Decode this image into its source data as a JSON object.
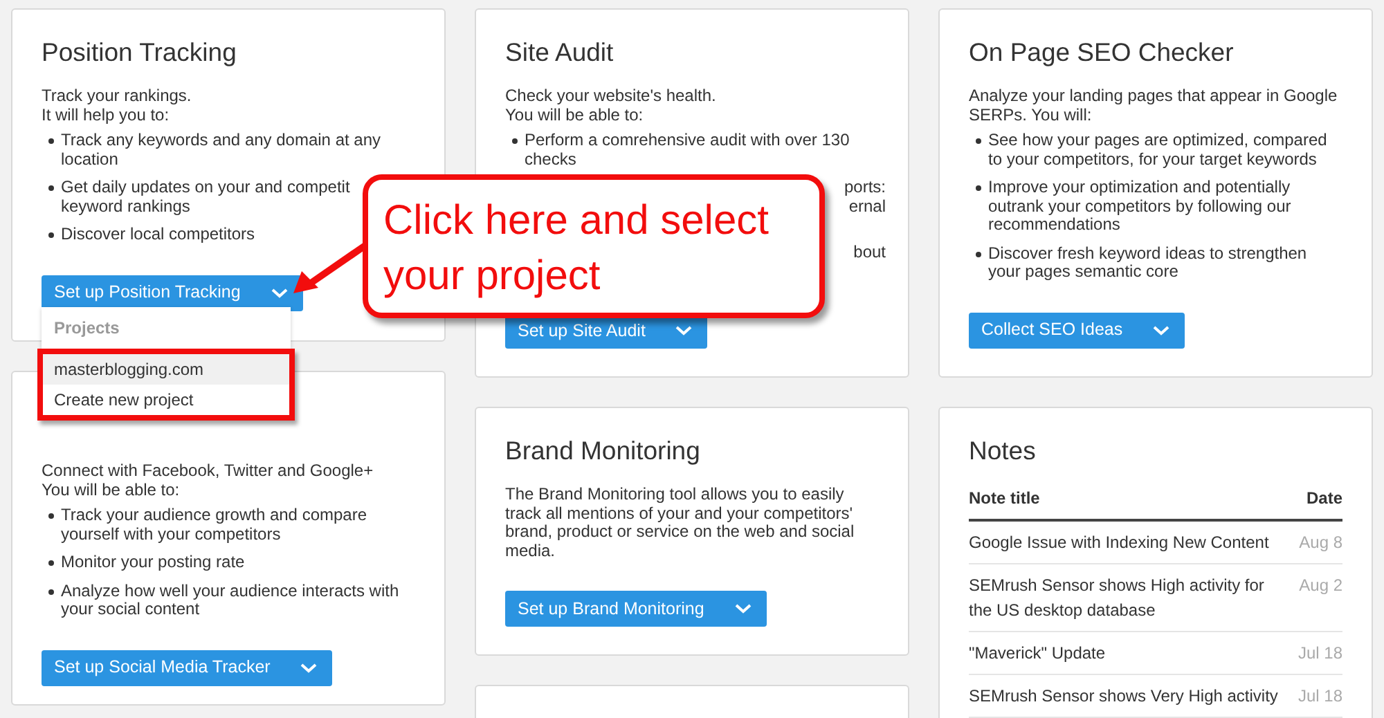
{
  "columns": [
    {
      "cards": [
        {
          "kind": "tool",
          "title": "Position Tracking",
          "intro": [
            "Track your rankings.",
            "It will help you to:"
          ],
          "bullets": [
            "Track any keywords and any domain at any location",
            "Get daily updates on your and competit\nkeyword rankings",
            "Discover local competitors"
          ],
          "button": "Set up Position Tracking"
        },
        {
          "kind": "tool",
          "intro": [
            "Connect with Facebook, Twitter and Google+",
            "You will be able to:"
          ],
          "bullets": [
            "Track your audience growth and compare yourself with your competitors",
            "Monitor your posting rate",
            "Analyze how well your audience interacts with your social content"
          ],
          "button": "Set up Social Media Tracker"
        }
      ]
    },
    {
      "cards": [
        {
          "kind": "tool",
          "title": "Site Audit",
          "intro": [
            "Check your website's health.",
            "You will be able to:"
          ],
          "bullets": [
            "Perform a comrehensive audit with over 130 checks"
          ],
          "covered_fragments": [
            "ports:",
            "ernal",
            "bout"
          ],
          "button": "Set up Site Audit"
        },
        {
          "kind": "tool",
          "title": "Brand Monitoring",
          "intro": [
            "The Brand Monitoring tool allows you to easily track all mentions of your and your competitors' brand, product or service on the web and social media."
          ],
          "button": "Set up Brand Monitoring"
        },
        {
          "kind": "empty"
        }
      ]
    },
    {
      "cards": [
        {
          "kind": "tool",
          "title": "On Page SEO Checker",
          "intro": [
            "Analyze your landing pages that appear in Google SERPs. You will:"
          ],
          "bullets": [
            "See how your pages are optimized, compared to your competitors, for your target keywords",
            "Improve your optimization and potentially outrank your competitors by following our recommendations",
            "Discover fresh keyword ideas to strengthen your pages semantic core"
          ],
          "button": "Collect SEO Ideas"
        },
        {
          "kind": "notes",
          "title": "Notes",
          "columns": [
            "Note title",
            "Date"
          ],
          "rows": [
            {
              "title": "Google Issue with Indexing New Content",
              "date": "Aug 8"
            },
            {
              "title": "SEMrush Sensor shows High activity for the US desktop database",
              "date": "Aug 2"
            },
            {
              "title": "\"Maverick\" Update",
              "date": "Jul 18"
            },
            {
              "title": "SEMrush Sensor shows Very High activity",
              "date": "Jul 18"
            }
          ]
        }
      ]
    }
  ],
  "dropdown": {
    "header": "Projects",
    "items": [
      {
        "label": "masterblogging.com",
        "selected": true
      },
      {
        "label": "Create new project",
        "selected": false
      }
    ]
  },
  "callout": "Click here and select your project"
}
